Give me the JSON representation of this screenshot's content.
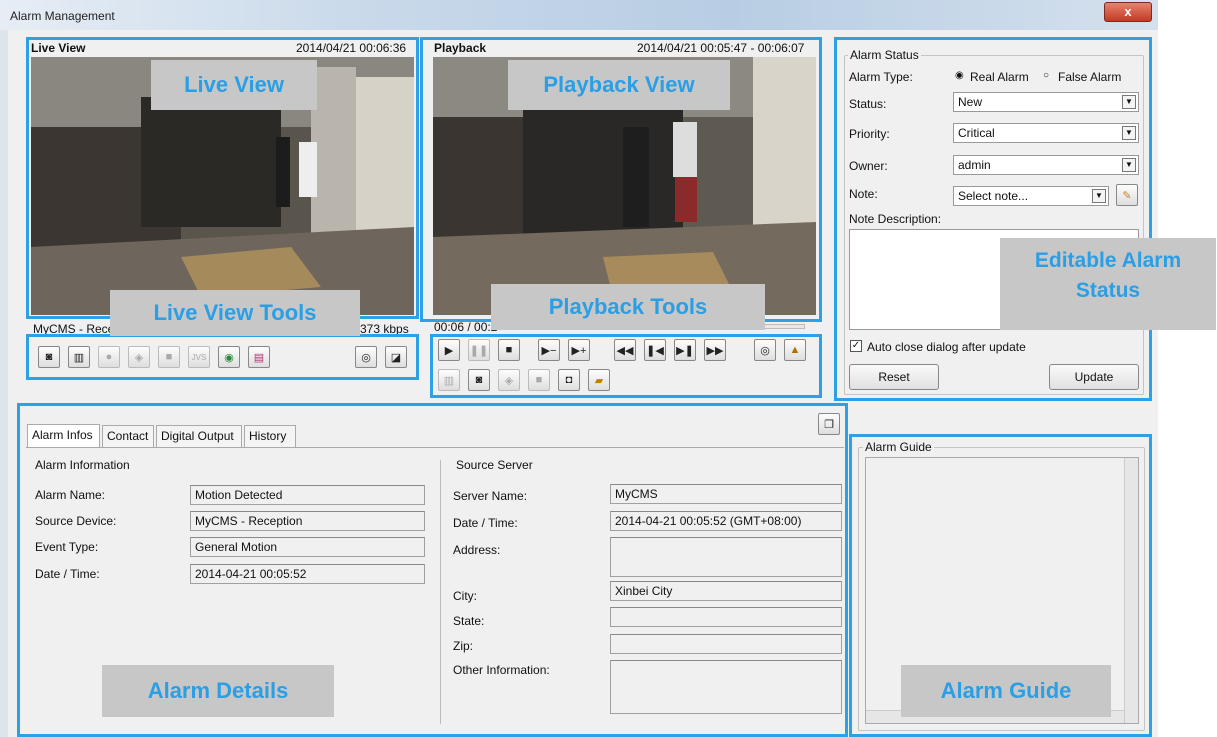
{
  "window": {
    "title": "Alarm Management",
    "close_label": "x"
  },
  "live": {
    "header_label": "Live View",
    "timestamp": "2014/04/21 00:06:36",
    "overlay": "Live View",
    "status_left": "MyCMS - Rece",
    "status_right": "373 kbps",
    "tools_overlay": "Live View Tools",
    "tools": [
      "snapshot-icon",
      "film-icon",
      "microphone-icon",
      "speaker-icon",
      "stop-record-icon",
      "jvs-icon",
      "globe-icon",
      "export-icon"
    ],
    "jvs_text": "JVS"
  },
  "playback": {
    "header_label": "Playback",
    "timestamp": "2014/04/21 00:05:47 - 00:06:07",
    "overlay": "Playback View",
    "time_text": "00:06 / 00:2",
    "tools_overlay": "Playback Tools",
    "progress": 0.0
  },
  "status": {
    "group_label": "Alarm Status",
    "alarm_type_label": "Alarm Type:",
    "real_alarm": "Real Alarm",
    "false_alarm": "False Alarm",
    "status_label": "Status:",
    "status_value": "New",
    "priority_label": "Priority:",
    "priority_value": "Critical",
    "owner_label": "Owner:",
    "owner_value": "admin",
    "note_label": "Note:",
    "note_value": "Select note...",
    "note_desc_label": "Note Description:",
    "overlay_line1": "Editable Alarm",
    "overlay_line2": "Status",
    "auto_close_label": "Auto close dialog after update",
    "reset_label": "Reset",
    "update_label": "Update"
  },
  "details": {
    "tabs": [
      "Alarm Infos",
      "Contact",
      "Digital Output",
      "History"
    ],
    "alarm_info_header": "Alarm Information",
    "alarm_name_label": "Alarm Name:",
    "alarm_name_value": "Motion Detected",
    "source_device_label": "Source Device:",
    "source_device_value": "MyCMS - Reception",
    "event_type_label": "Event Type:",
    "event_type_value": "General Motion",
    "datetime_label": "Date / Time:",
    "datetime_value": "2014-04-21 00:05:52",
    "source_server_header": "Source Server",
    "server_name_label": "Server Name:",
    "server_name_value": "MyCMS",
    "server_datetime_label": "Date / Time:",
    "server_datetime_value": "2014-04-21 00:05:52 (GMT+08:00)",
    "address_label": "Address:",
    "city_label": "City:",
    "city_value": "Xinbei City",
    "state_label": "State:",
    "zip_label": "Zip:",
    "other_info_label": "Other Information:",
    "overlay": "Alarm Details"
  },
  "guide": {
    "group_label": "Alarm Guide",
    "overlay": "Alarm Guide"
  }
}
